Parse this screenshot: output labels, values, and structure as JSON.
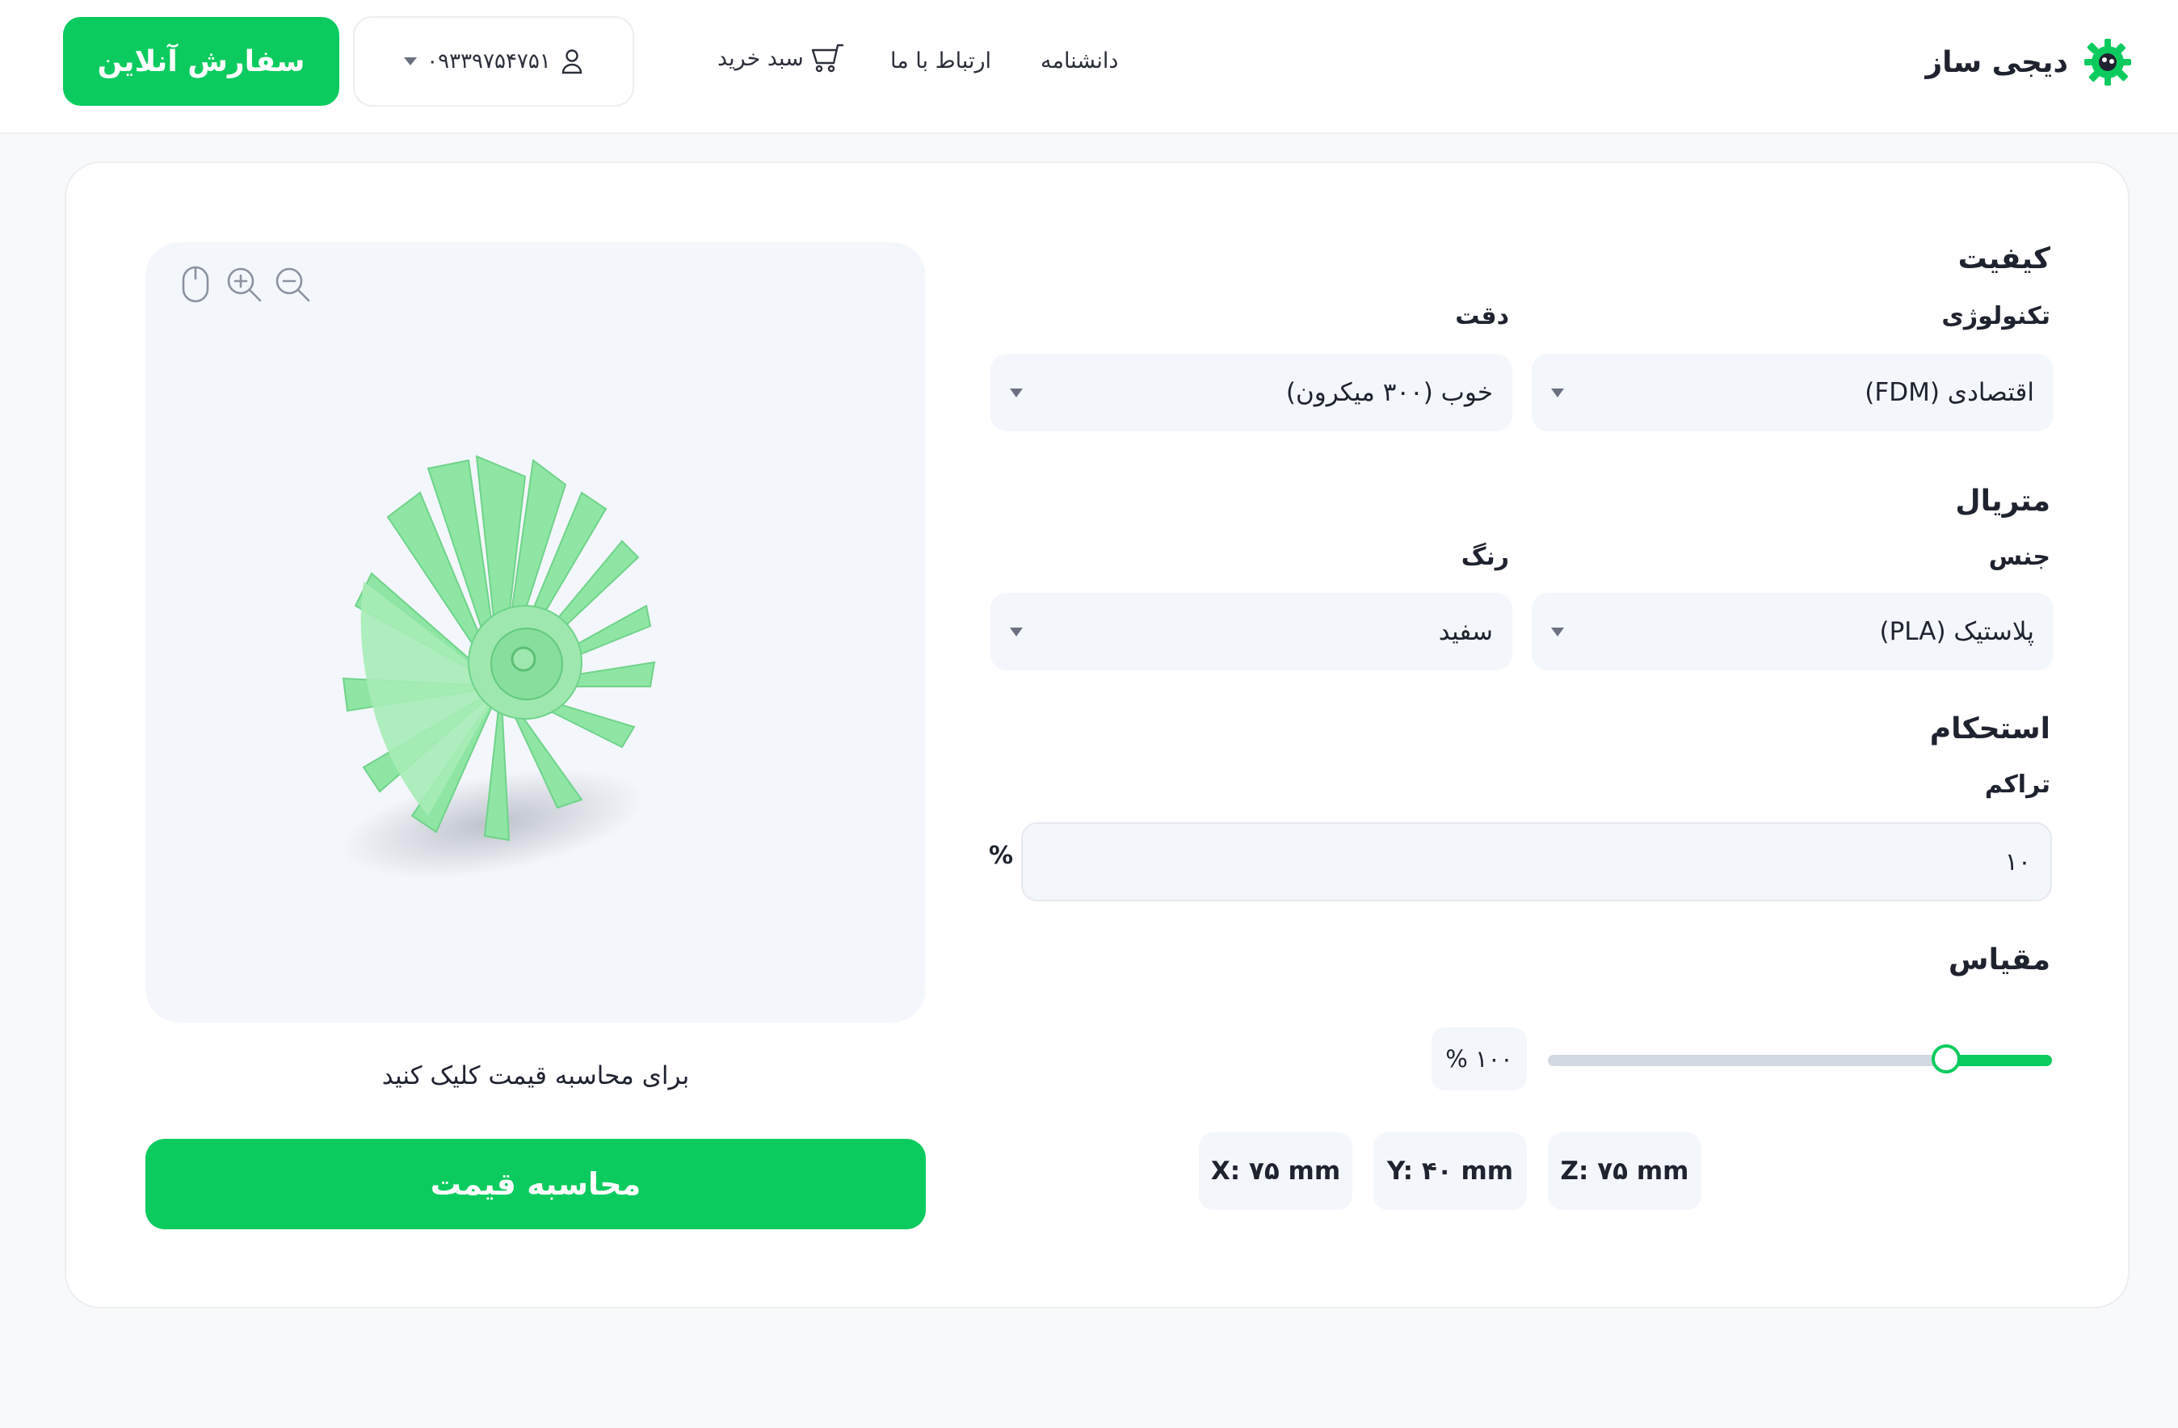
{
  "header": {
    "brand": "دیجی ساز",
    "nav": {
      "wiki": "دانشنامه",
      "contact": "ارتباط با ما",
      "cart": "سبد خرید"
    },
    "user_phone": "۰۹۳۳۹۷۵۴۷۵۱",
    "order_button": "سفارش آنلاین"
  },
  "viewer": {
    "tools": [
      "mouse-icon",
      "zoom-in-icon",
      "zoom-out-icon"
    ],
    "hint": "برای محاسبه قیمت کلیک کنید",
    "calc_button": "محاسبه قیمت"
  },
  "form": {
    "quality": {
      "title": "کیفیت",
      "technology_label": "تکنولوژی",
      "technology_value": "اقتصادی (FDM)",
      "precision_label": "دقت",
      "precision_value": "خوب (۳۰۰ میکرون)"
    },
    "material": {
      "title": "متریال",
      "type_label": "جنس",
      "type_value": "پلاستیک (PLA)",
      "color_label": "رنگ",
      "color_value": "سفید"
    },
    "strength": {
      "title": "استحکام",
      "density_label": "تراکم",
      "density_value": "۱۰",
      "density_unit": "%"
    },
    "scale": {
      "title": "مقیاس",
      "value_label": "% ۱۰۰",
      "slider_fraction": 0.21,
      "dims": {
        "x": "X: ۷۵ mm",
        "y": "Y: ۴۰ mm",
        "z": "Z: ۷۵ mm"
      }
    }
  },
  "colors": {
    "accent": "#0ccb5e",
    "panel": "#f3f6fb",
    "model": "#8fe6a4"
  }
}
